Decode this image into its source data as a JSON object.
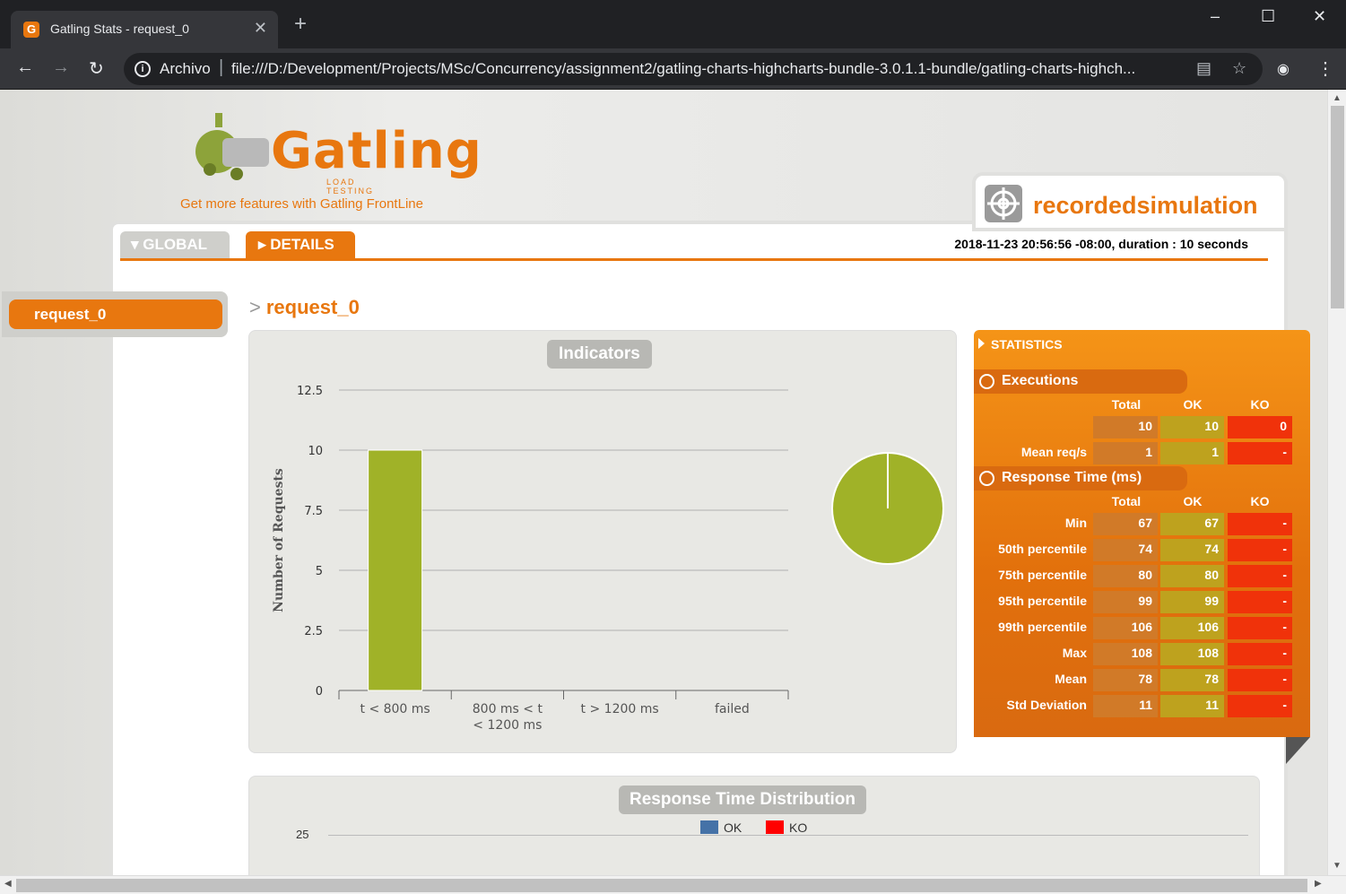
{
  "browser": {
    "tab_title": "Gatling Stats - request_0",
    "tab_favicon": "G",
    "tab_close": "✕",
    "new_tab": "+",
    "omnibox_label": "Archivo",
    "omnibox_separator": "|",
    "url": "file:///D:/Development/Projects/MSc/Concurrency/assignment2/gatling-charts-highcharts-bundle-3.0.1.1-bundle/gatling-charts-highch..."
  },
  "page": {
    "logo_text": "Gatling",
    "logo_sub": "LOAD TESTING",
    "frontline_link": "Get more features with Gatling FrontLine",
    "simulation_name": "recordedsimulation",
    "tabs": {
      "global": "GLOBAL",
      "details": "DETAILS"
    },
    "run_info": "2018-11-23 20:56:56 -08:00, duration : 10 seconds",
    "menu": [
      {
        "label": "request_0"
      }
    ],
    "request_title": "request_0",
    "request_prefix": ">",
    "indicators_title": "Indicators",
    "distribution_title": "Response Time Distribution",
    "distribution_first_tick": "25",
    "legend": [
      {
        "label": "OK",
        "color": "#4572a7"
      },
      {
        "label": "KO",
        "color": "#ff0000"
      }
    ]
  },
  "chart_data": [
    {
      "type": "bar",
      "title": "Indicators",
      "categories": [
        "t < 800 ms",
        "800 ms < t < 1200 ms",
        "t > 1200 ms",
        "failed"
      ],
      "values": [
        10,
        0,
        0,
        0
      ],
      "ylabel": "Number of Requests",
      "ylim": [
        0,
        12.5
      ],
      "yticks": [
        "0",
        "2.5",
        "5",
        "7.5",
        "10",
        "12.5"
      ],
      "color": "#a0b228",
      "grid": true
    },
    {
      "type": "pie",
      "slices": [
        {
          "label": "t < 800 ms",
          "value": 10,
          "color": "#a0b228"
        }
      ]
    }
  ],
  "stats": {
    "heading": "STATISTICS",
    "executions": {
      "title": "Executions",
      "columns": [
        "Total",
        "OK",
        "KO"
      ],
      "rows": [
        {
          "label": "",
          "total": "10",
          "ok": "10",
          "ko": "0"
        },
        {
          "label": "Mean req/s",
          "total": "1",
          "ok": "1",
          "ko": "-"
        }
      ]
    },
    "response_time": {
      "title": "Response Time (ms)",
      "columns": [
        "Total",
        "OK",
        "KO"
      ],
      "rows": [
        {
          "label": "Min",
          "total": "67",
          "ok": "67",
          "ko": "-"
        },
        {
          "label": "50th percentile",
          "total": "74",
          "ok": "74",
          "ko": "-"
        },
        {
          "label": "75th percentile",
          "total": "80",
          "ok": "80",
          "ko": "-"
        },
        {
          "label": "95th percentile",
          "total": "99",
          "ok": "99",
          "ko": "-"
        },
        {
          "label": "99th percentile",
          "total": "106",
          "ok": "106",
          "ko": "-"
        },
        {
          "label": "Max",
          "total": "108",
          "ok": "108",
          "ko": "-"
        },
        {
          "label": "Mean",
          "total": "78",
          "ok": "78",
          "ko": "-"
        },
        {
          "label": "Std Deviation",
          "total": "11",
          "ok": "11",
          "ko": "-"
        }
      ]
    }
  }
}
